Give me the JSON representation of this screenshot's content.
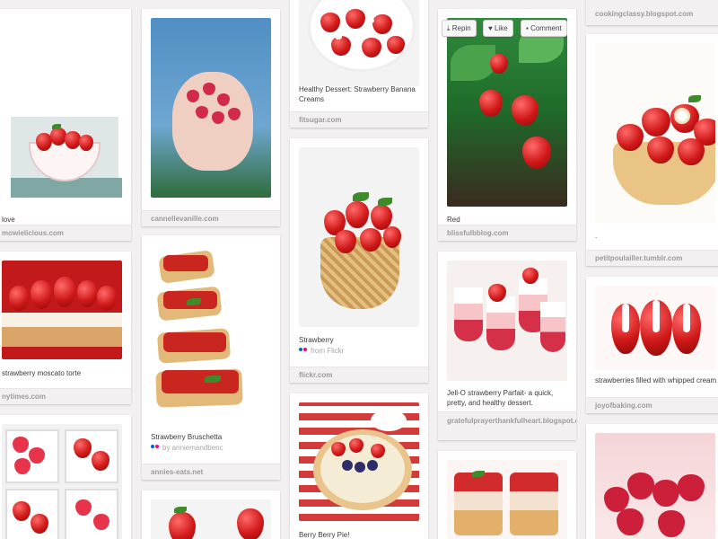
{
  "actions": {
    "repin_label": "Repin",
    "like_label": "Like",
    "comment_label": "Comment"
  },
  "pins": {
    "c1p1": {
      "description": "love",
      "source": "mowielicious.com"
    },
    "c1p2": {
      "description": "strawberry moscato torte",
      "source": "nytimes.com"
    },
    "c2p1": {
      "description": "",
      "source": "cannellevanille.com"
    },
    "c2p2": {
      "description": "Strawberry Bruschetta",
      "via": "by anniemandbenc",
      "source": "annies-eats.net"
    },
    "c3p1": {
      "description": "Healthy Dessert: Strawberry Banana Creams",
      "source": "fitsugar.com"
    },
    "c3p2": {
      "description": "Strawberry",
      "via": "from Flickr",
      "source": "flickr.com"
    },
    "c3p3": {
      "description": "Berry Berry Pie!"
    },
    "c4p1": {
      "description": "Red",
      "source": "blissfulbblog.com"
    },
    "c4p2": {
      "description": "Jell-O strawberry Parfait- a quick, pretty, and healthy dessert.",
      "source": "gratefulprayerthankfulheart.blogspot.com"
    },
    "c5p0": {
      "source": "cookingclassy.blogspot.com"
    },
    "c5p1": {
      "description": ".",
      "source": "petitpoulailler.tumblr.com"
    },
    "c5p2": {
      "description": "strawberries filled with whipped cream",
      "source": "joyofbaking.com"
    }
  },
  "colors": {
    "background": "#f2f0f0",
    "card": "#ffffff",
    "source_text": "#9c9a9a",
    "berry_red": "#d01818"
  }
}
